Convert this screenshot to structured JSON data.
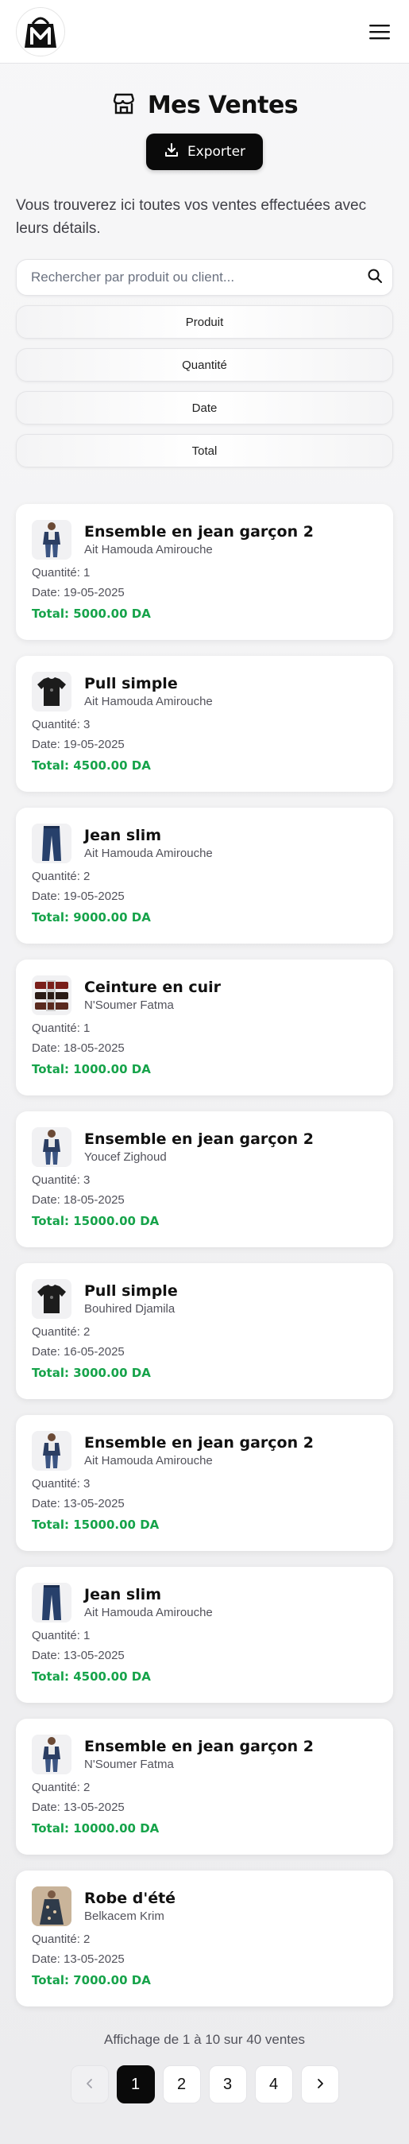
{
  "header": {
    "logo_icon": "shopping-bag-m-logo-icon",
    "menu_icon": "hamburger-menu-icon"
  },
  "page": {
    "title": "Mes Ventes",
    "title_icon": "store-icon",
    "export_label": "Exporter",
    "export_icon": "download-icon",
    "intro": "Vous trouverez ici toutes vos ventes effectuées avec leurs détails."
  },
  "search": {
    "placeholder": "Rechercher par produit ou client...",
    "value": "",
    "icon": "search-icon"
  },
  "sort_buttons": [
    "Produit",
    "Quantité",
    "Date",
    "Total"
  ],
  "labels": {
    "quantity": "Quantité:",
    "date": "Date:",
    "total": "Total:"
  },
  "colors": {
    "accent": "#0a0a0a",
    "total_green": "#16a34a"
  },
  "sales": [
    {
      "product": "Ensemble en jean garçon 2",
      "client": "Ait Hamouda Amirouche",
      "quantity": "1",
      "date": "19-05-2025",
      "total": "5000.00 DA",
      "thumb": "denim-set-thumb"
    },
    {
      "product": "Pull simple",
      "client": "Ait Hamouda Amirouche",
      "quantity": "3",
      "date": "19-05-2025",
      "total": "4500.00 DA",
      "thumb": "black-tshirt-thumb"
    },
    {
      "product": "Jean slim",
      "client": "Ait Hamouda Amirouche",
      "quantity": "2",
      "date": "19-05-2025",
      "total": "9000.00 DA",
      "thumb": "jeans-thumb"
    },
    {
      "product": "Ceinture en cuir",
      "client": "N'Soumer Fatma",
      "quantity": "1",
      "date": "18-05-2025",
      "total": "1000.00 DA",
      "thumb": "belts-thumb"
    },
    {
      "product": "Ensemble en jean garçon 2",
      "client": "Youcef Zighoud",
      "quantity": "3",
      "date": "18-05-2025",
      "total": "15000.00 DA",
      "thumb": "denim-set-thumb"
    },
    {
      "product": "Pull simple",
      "client": "Bouhired Djamila",
      "quantity": "2",
      "date": "16-05-2025",
      "total": "3000.00 DA",
      "thumb": "black-tshirt-thumb"
    },
    {
      "product": "Ensemble en jean garçon 2",
      "client": "Ait Hamouda Amirouche",
      "quantity": "3",
      "date": "13-05-2025",
      "total": "15000.00 DA",
      "thumb": "denim-set-thumb"
    },
    {
      "product": "Jean slim",
      "client": "Ait Hamouda Amirouche",
      "quantity": "1",
      "date": "13-05-2025",
      "total": "4500.00 DA",
      "thumb": "jeans-thumb"
    },
    {
      "product": "Ensemble en jean garçon 2",
      "client": "N'Soumer Fatma",
      "quantity": "2",
      "date": "13-05-2025",
      "total": "10000.00 DA",
      "thumb": "denim-set-thumb"
    },
    {
      "product": "Robe d'été",
      "client": "Belkacem Krim",
      "quantity": "2",
      "date": "13-05-2025",
      "total": "7000.00 DA",
      "thumb": "summer-dress-thumb"
    }
  ],
  "pagination": {
    "info": "Affichage de 1 à 10 sur 40 ventes",
    "prev_icon": "chevron-left-icon",
    "next_icon": "chevron-right-icon",
    "pages": [
      "1",
      "2",
      "3",
      "4"
    ],
    "current": "1"
  }
}
